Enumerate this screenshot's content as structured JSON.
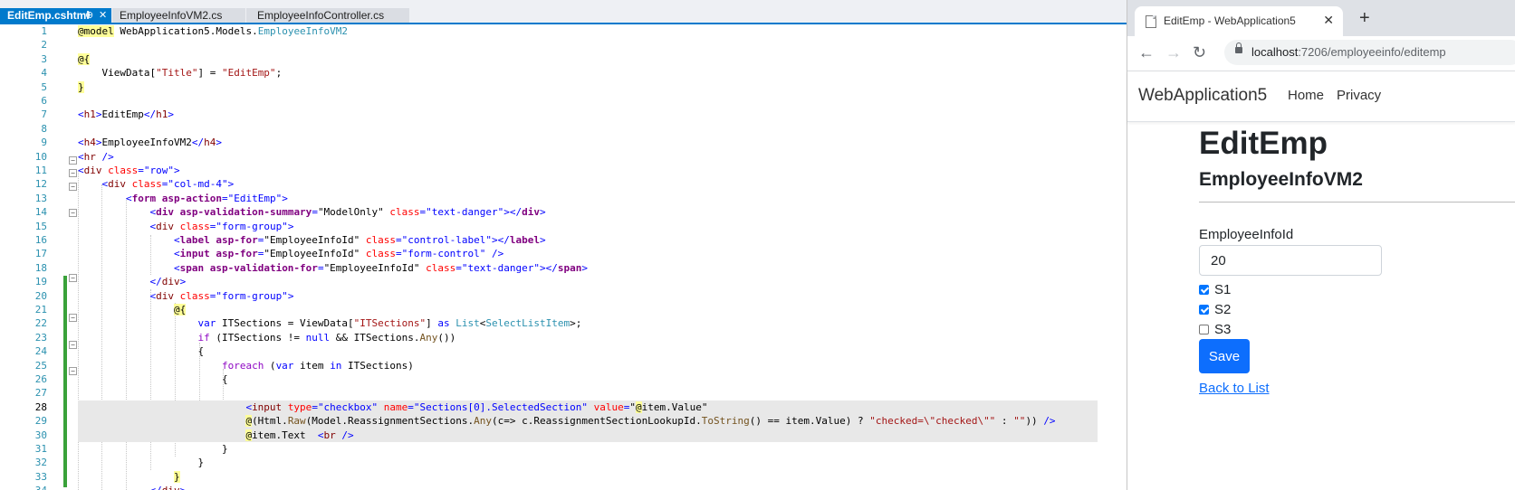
{
  "ide": {
    "tabs": [
      {
        "label": "EditEmp.cshtml",
        "pin": "⊕",
        "close": "✕"
      },
      {
        "label": "EmployeeInfoVM2.cs"
      },
      {
        "label": "EmployeeInfoController.cs"
      }
    ],
    "line_numbers": [
      "1",
      "2",
      "3",
      "4",
      "5",
      "6",
      "7",
      "8",
      "9",
      "10",
      "11",
      "12",
      "13",
      "14",
      "15",
      "16",
      "17",
      "18",
      "19",
      "20",
      "21",
      "22",
      "23",
      "24",
      "25",
      "26",
      "27",
      "28",
      "29",
      "30",
      "31",
      "32",
      "33",
      "34"
    ],
    "current_line": "28"
  },
  "browser": {
    "tab_title": "EditEmp - WebApplication5",
    "tab_close": "✕",
    "new_tab": "+",
    "url_host": "localhost",
    "url_path": ":7206/employeeinfo/editemp",
    "nav_back": "←",
    "nav_forward": "→",
    "nav_reload": "↻"
  },
  "site": {
    "brand": "WebApplication5",
    "nav": [
      "Home",
      "Privacy"
    ],
    "heading": "EditEmp",
    "subheading": "EmployeeInfoVM2",
    "field_label": "EmployeeInfoId",
    "field_value": "20",
    "checkboxes": [
      {
        "label": "S1",
        "checked": true
      },
      {
        "label": "S2",
        "checked": true
      },
      {
        "label": "S3",
        "checked": false
      }
    ],
    "save_label": "Save",
    "back_link": "Back to List"
  }
}
